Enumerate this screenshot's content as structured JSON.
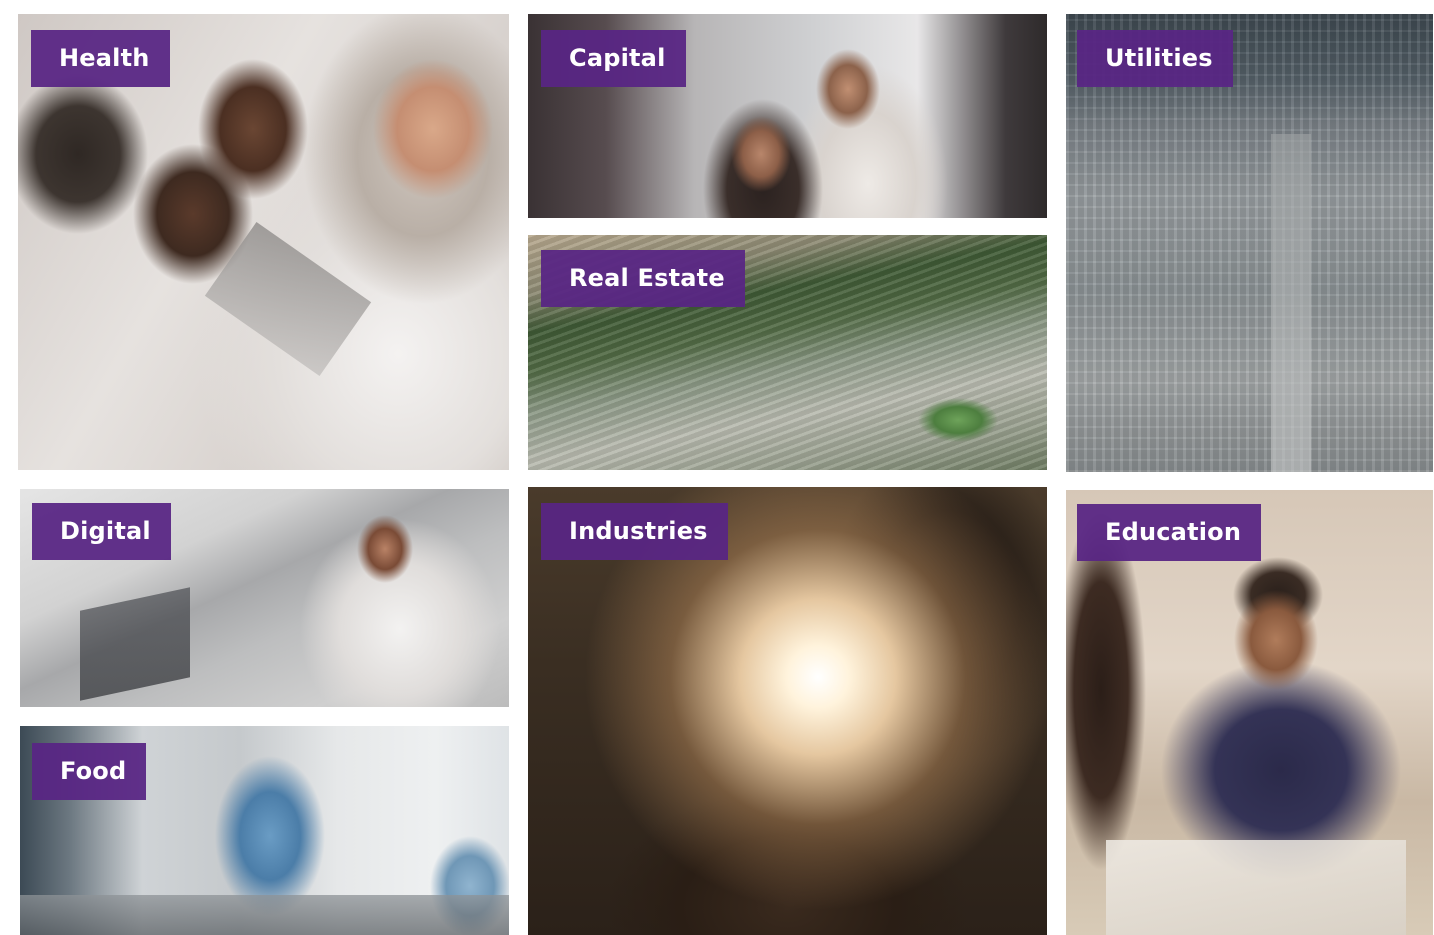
{
  "tiles": {
    "health": {
      "label": "Health",
      "image": "doctor-with-clipboard-photo"
    },
    "capital": {
      "label": "Capital",
      "image": "business-people-city-photo"
    },
    "utilities": {
      "label": "Utilities",
      "image": "aerial-city-photo"
    },
    "real_estate": {
      "label": "Real Estate",
      "image": "aerial-residential-development-photo"
    },
    "digital": {
      "label": "Digital",
      "image": "man-on-phone-with-laptop-photo"
    },
    "industries": {
      "label": "Industries",
      "image": "welding-sparks-photo"
    },
    "education": {
      "label": "Education",
      "image": "students-studying-photo"
    },
    "food": {
      "label": "Food",
      "image": "food-lab-workers-photo"
    }
  },
  "colors": {
    "label_background": "#582584",
    "label_text": "#ffffff",
    "page_background": "#ffffff"
  }
}
